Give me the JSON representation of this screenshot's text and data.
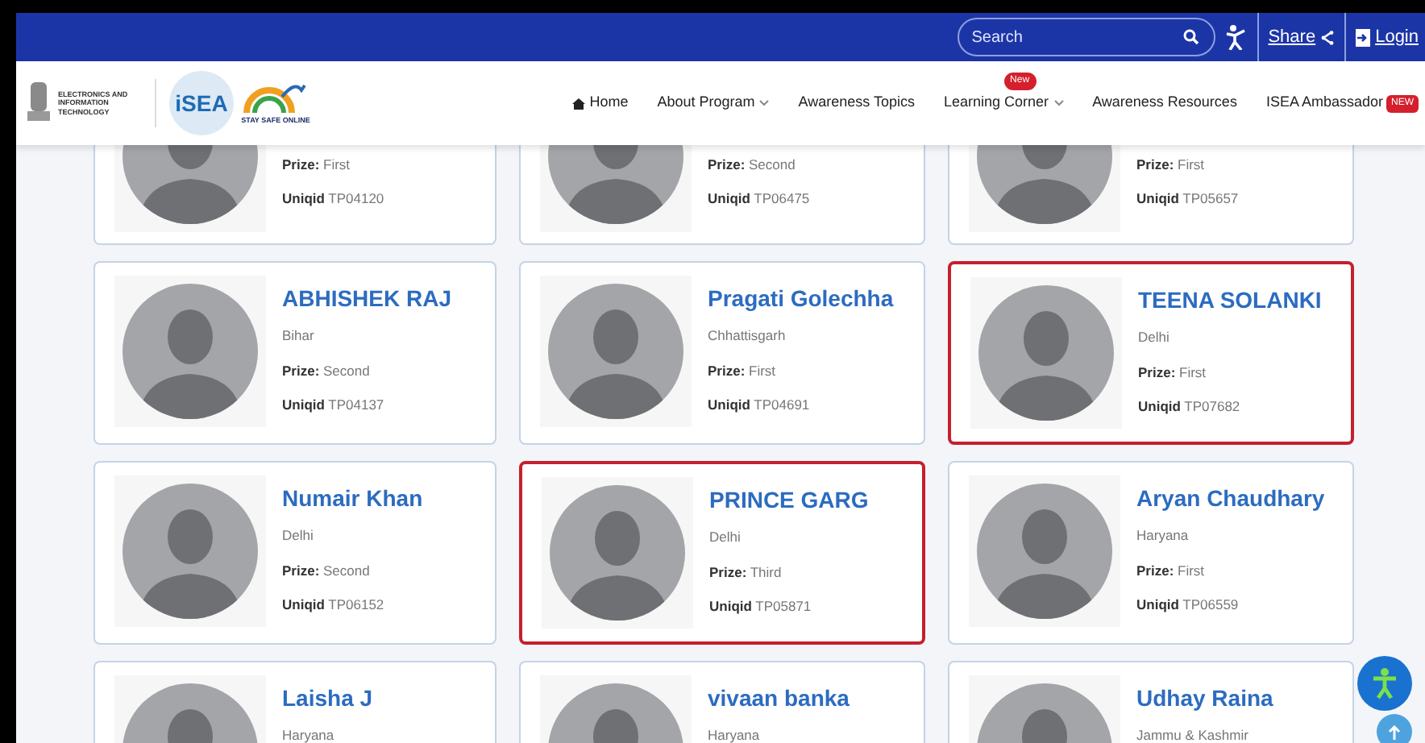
{
  "topbar": {
    "search": {
      "placeholder": "Search"
    },
    "share": "Share",
    "login": "Login"
  },
  "header": {
    "ministry_logo_text": "ELECTRONICS AND INFORMATION TECHNOLOGY",
    "isea_logo_text": "iSEA",
    "safe_logo_text": "STAY SAFE ONLINE",
    "nav": [
      {
        "label": "Home",
        "kind": "home"
      },
      {
        "label": "About Program",
        "kind": "dropdown"
      },
      {
        "label": "Awareness Topics",
        "kind": "plain"
      },
      {
        "label": "Learning Corner",
        "kind": "dropdown",
        "badge": "New"
      },
      {
        "label": "Awareness Resources",
        "kind": "plain"
      },
      {
        "label": "ISEA Ambassador",
        "kind": "plain",
        "tag": "NEW"
      }
    ]
  },
  "cards": [
    {
      "prize": "**Prize:** First",
      "uniqid": "**Uniqid** TP04120",
      "highlighted": false
    },
    {
      "prize": "**Prize:** Second",
      "uniqid": "**Uniqid** TP06475",
      "highlighted": false
    },
    {
      "prize": "**Prize:** First",
      "uniqid": "**Uniqid** TP05657",
      "highlighted": false
    },
    {
      "name": "ABHISHEK RAJ",
      "state": "Bihar",
      "prize": "**Prize:** Second",
      "uniqid": "**Uniqid** TP04137",
      "highlighted": false
    },
    {
      "name": "Pragati Golechha",
      "state": "Chhattisgarh",
      "prize": "**Prize:** First",
      "uniqid": "**Uniqid** TP04691",
      "highlighted": false
    },
    {
      "name": "TEENA SOLANKI",
      "state": "Delhi",
      "prize": "**Prize:** First",
      "uniqid": "**Uniqid** TP07682",
      "highlighted": true
    },
    {
      "name": "Numair Khan",
      "state": "Delhi",
      "prize": "**Prize:** Second",
      "uniqid": "**Uniqid** TP06152",
      "highlighted": false
    },
    {
      "name": "PRINCE GARG",
      "state": "Delhi",
      "prize": "**Prize:** Third",
      "uniqid": "**Uniqid** TP05871",
      "highlighted": true
    },
    {
      "name": "Aryan Chaudhary",
      "state": "Haryana",
      "prize": "**Prize:** First",
      "uniqid": "**Uniqid** TP06559",
      "highlighted": false
    },
    {
      "name": "Laisha J",
      "state": "Haryana",
      "highlighted": false
    },
    {
      "name": "vivaan banka",
      "state": "Haryana",
      "highlighted": false
    },
    {
      "name": "Udhay Raina",
      "state": "Jammu & Kashmir",
      "highlighted": false
    }
  ]
}
